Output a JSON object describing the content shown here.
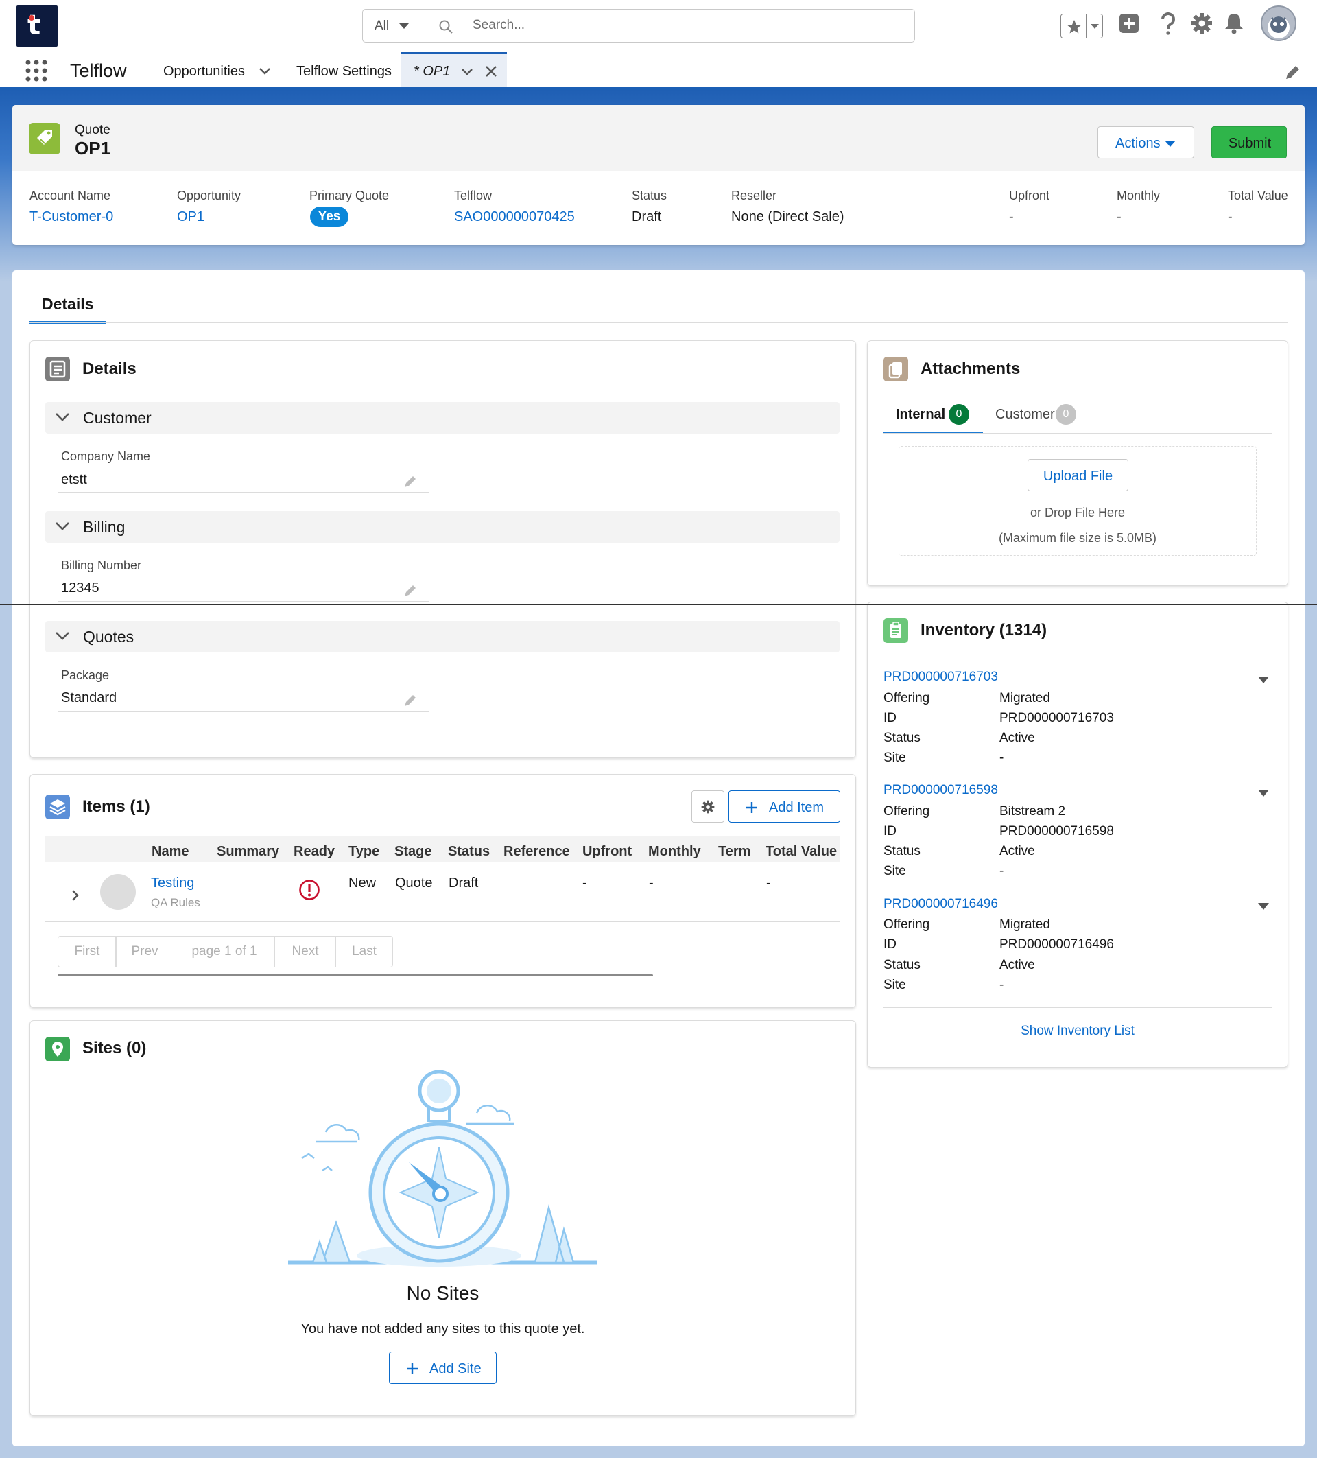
{
  "header": {
    "logo_letter": "t",
    "search_scope": "All",
    "search_placeholder": "Search..."
  },
  "nav": {
    "app_name": "Telflow",
    "items": [
      "Opportunities",
      "Telflow Settings"
    ],
    "active_tab": "* OP1"
  },
  "record": {
    "object_label": "Quote",
    "name": "OP1",
    "actions_label": "Actions",
    "submit_label": "Submit",
    "fields": [
      {
        "label": "Account Name",
        "value": "T-Customer-0"
      },
      {
        "label": "Opportunity",
        "value": "OP1"
      },
      {
        "label": "Primary Quote",
        "value": "Yes"
      },
      {
        "label": "Telflow",
        "value": "SAO000000070425"
      },
      {
        "label": "Status",
        "value": "Draft"
      },
      {
        "label": "Reseller",
        "value": "None (Direct Sale)"
      },
      {
        "label": "Upfront",
        "value": "-"
      },
      {
        "label": "Monthly",
        "value": "-"
      },
      {
        "label": "Total Value",
        "value": "-"
      }
    ]
  },
  "tabs": {
    "details": "Details"
  },
  "details": {
    "title": "Details",
    "sections": [
      {
        "title": "Customer",
        "field_label": "Company Name",
        "field_value": "etstt"
      },
      {
        "title": "Billing",
        "field_label": "Billing Number",
        "field_value": "12345"
      },
      {
        "title": "Quotes",
        "field_label": "Package",
        "field_value": "Standard"
      }
    ]
  },
  "items": {
    "title": "Items (1)",
    "add_label": "Add Item",
    "columns": [
      "Name",
      "Summary",
      "Ready",
      "Type",
      "Stage",
      "Status",
      "Reference",
      "Upfront",
      "Monthly",
      "Term",
      "Total Value"
    ],
    "rows": [
      {
        "name": "Testing",
        "sub": "QA Rules",
        "type": "New",
        "stage": "Quote",
        "status": "Draft",
        "upfront": "-",
        "monthly": "-",
        "total": "-"
      }
    ],
    "pager": {
      "first": "First",
      "prev": "Prev",
      "page": "page 1 of 1",
      "next": "Next",
      "last": "Last"
    }
  },
  "sites": {
    "title": "Sites (0)",
    "empty_title": "No Sites",
    "empty_text": "You have not added any sites to this quote yet.",
    "add_label": "Add Site"
  },
  "attachments": {
    "title": "Attachments",
    "tab_internal": "Internal",
    "internal_count": "0",
    "tab_customer": "Customer",
    "customer_count": "0",
    "upload_label": "Upload File",
    "drop_text": "or Drop File Here",
    "max_text": "(Maximum file size is 5.0MB)"
  },
  "inventory": {
    "title": "Inventory (1314)",
    "labels": {
      "offering": "Offering",
      "id": "ID",
      "status": "Status",
      "site": "Site"
    },
    "items": [
      {
        "link": "PRD000000716703",
        "offering": "Migrated",
        "id": "PRD000000716703",
        "status": "Active",
        "site": "-"
      },
      {
        "link": "PRD000000716598",
        "offering": "Bitstream 2",
        "id": "PRD000000716598",
        "status": "Active",
        "site": "-"
      },
      {
        "link": "PRD000000716496",
        "offering": "Migrated",
        "id": "PRD000000716496",
        "status": "Active",
        "site": "-"
      }
    ],
    "show_list": "Show Inventory List"
  },
  "colors": {
    "brand": "#1b5fb5",
    "link": "#0b6bcb",
    "submit": "#2fb54a",
    "primary_badge": "#0b87d9"
  }
}
